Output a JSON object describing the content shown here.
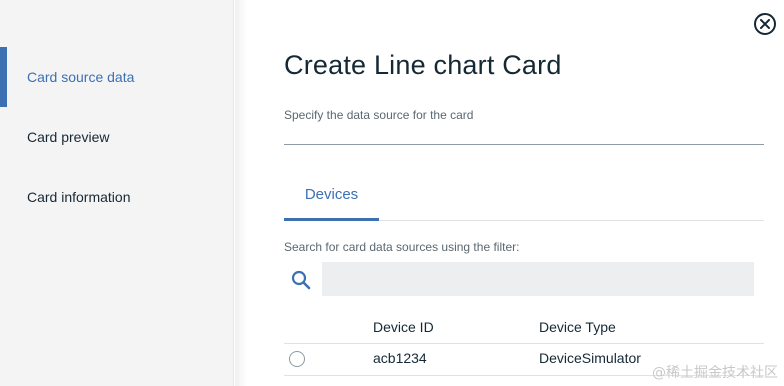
{
  "sidebar": {
    "items": [
      {
        "label": "Card source data",
        "active": true
      },
      {
        "label": "Card preview",
        "active": false
      },
      {
        "label": "Card information",
        "active": false
      }
    ]
  },
  "dialog": {
    "title": "Create Line chart Card",
    "subtitle": "Specify the data source for the card"
  },
  "tabs": [
    {
      "label": "Devices",
      "selected": true
    }
  ],
  "filter": {
    "label": "Search for card data sources using the filter:",
    "value": "",
    "placeholder": ""
  },
  "table": {
    "headers": [
      "Device ID",
      "Device Type"
    ],
    "rows": [
      {
        "device_id": "acb1234",
        "device_type": "DeviceSimulator"
      }
    ]
  },
  "watermark": "@稀土掘金技术社区",
  "icons": {
    "close": "close-circle-icon",
    "search": "search-icon",
    "radio": "radio-unselected"
  },
  "colors": {
    "accent": "#3d70b2",
    "text": "#152935",
    "muted": "#5a6872",
    "sidebar_bg": "#f4f4f4",
    "input_bg": "#eceeef"
  }
}
